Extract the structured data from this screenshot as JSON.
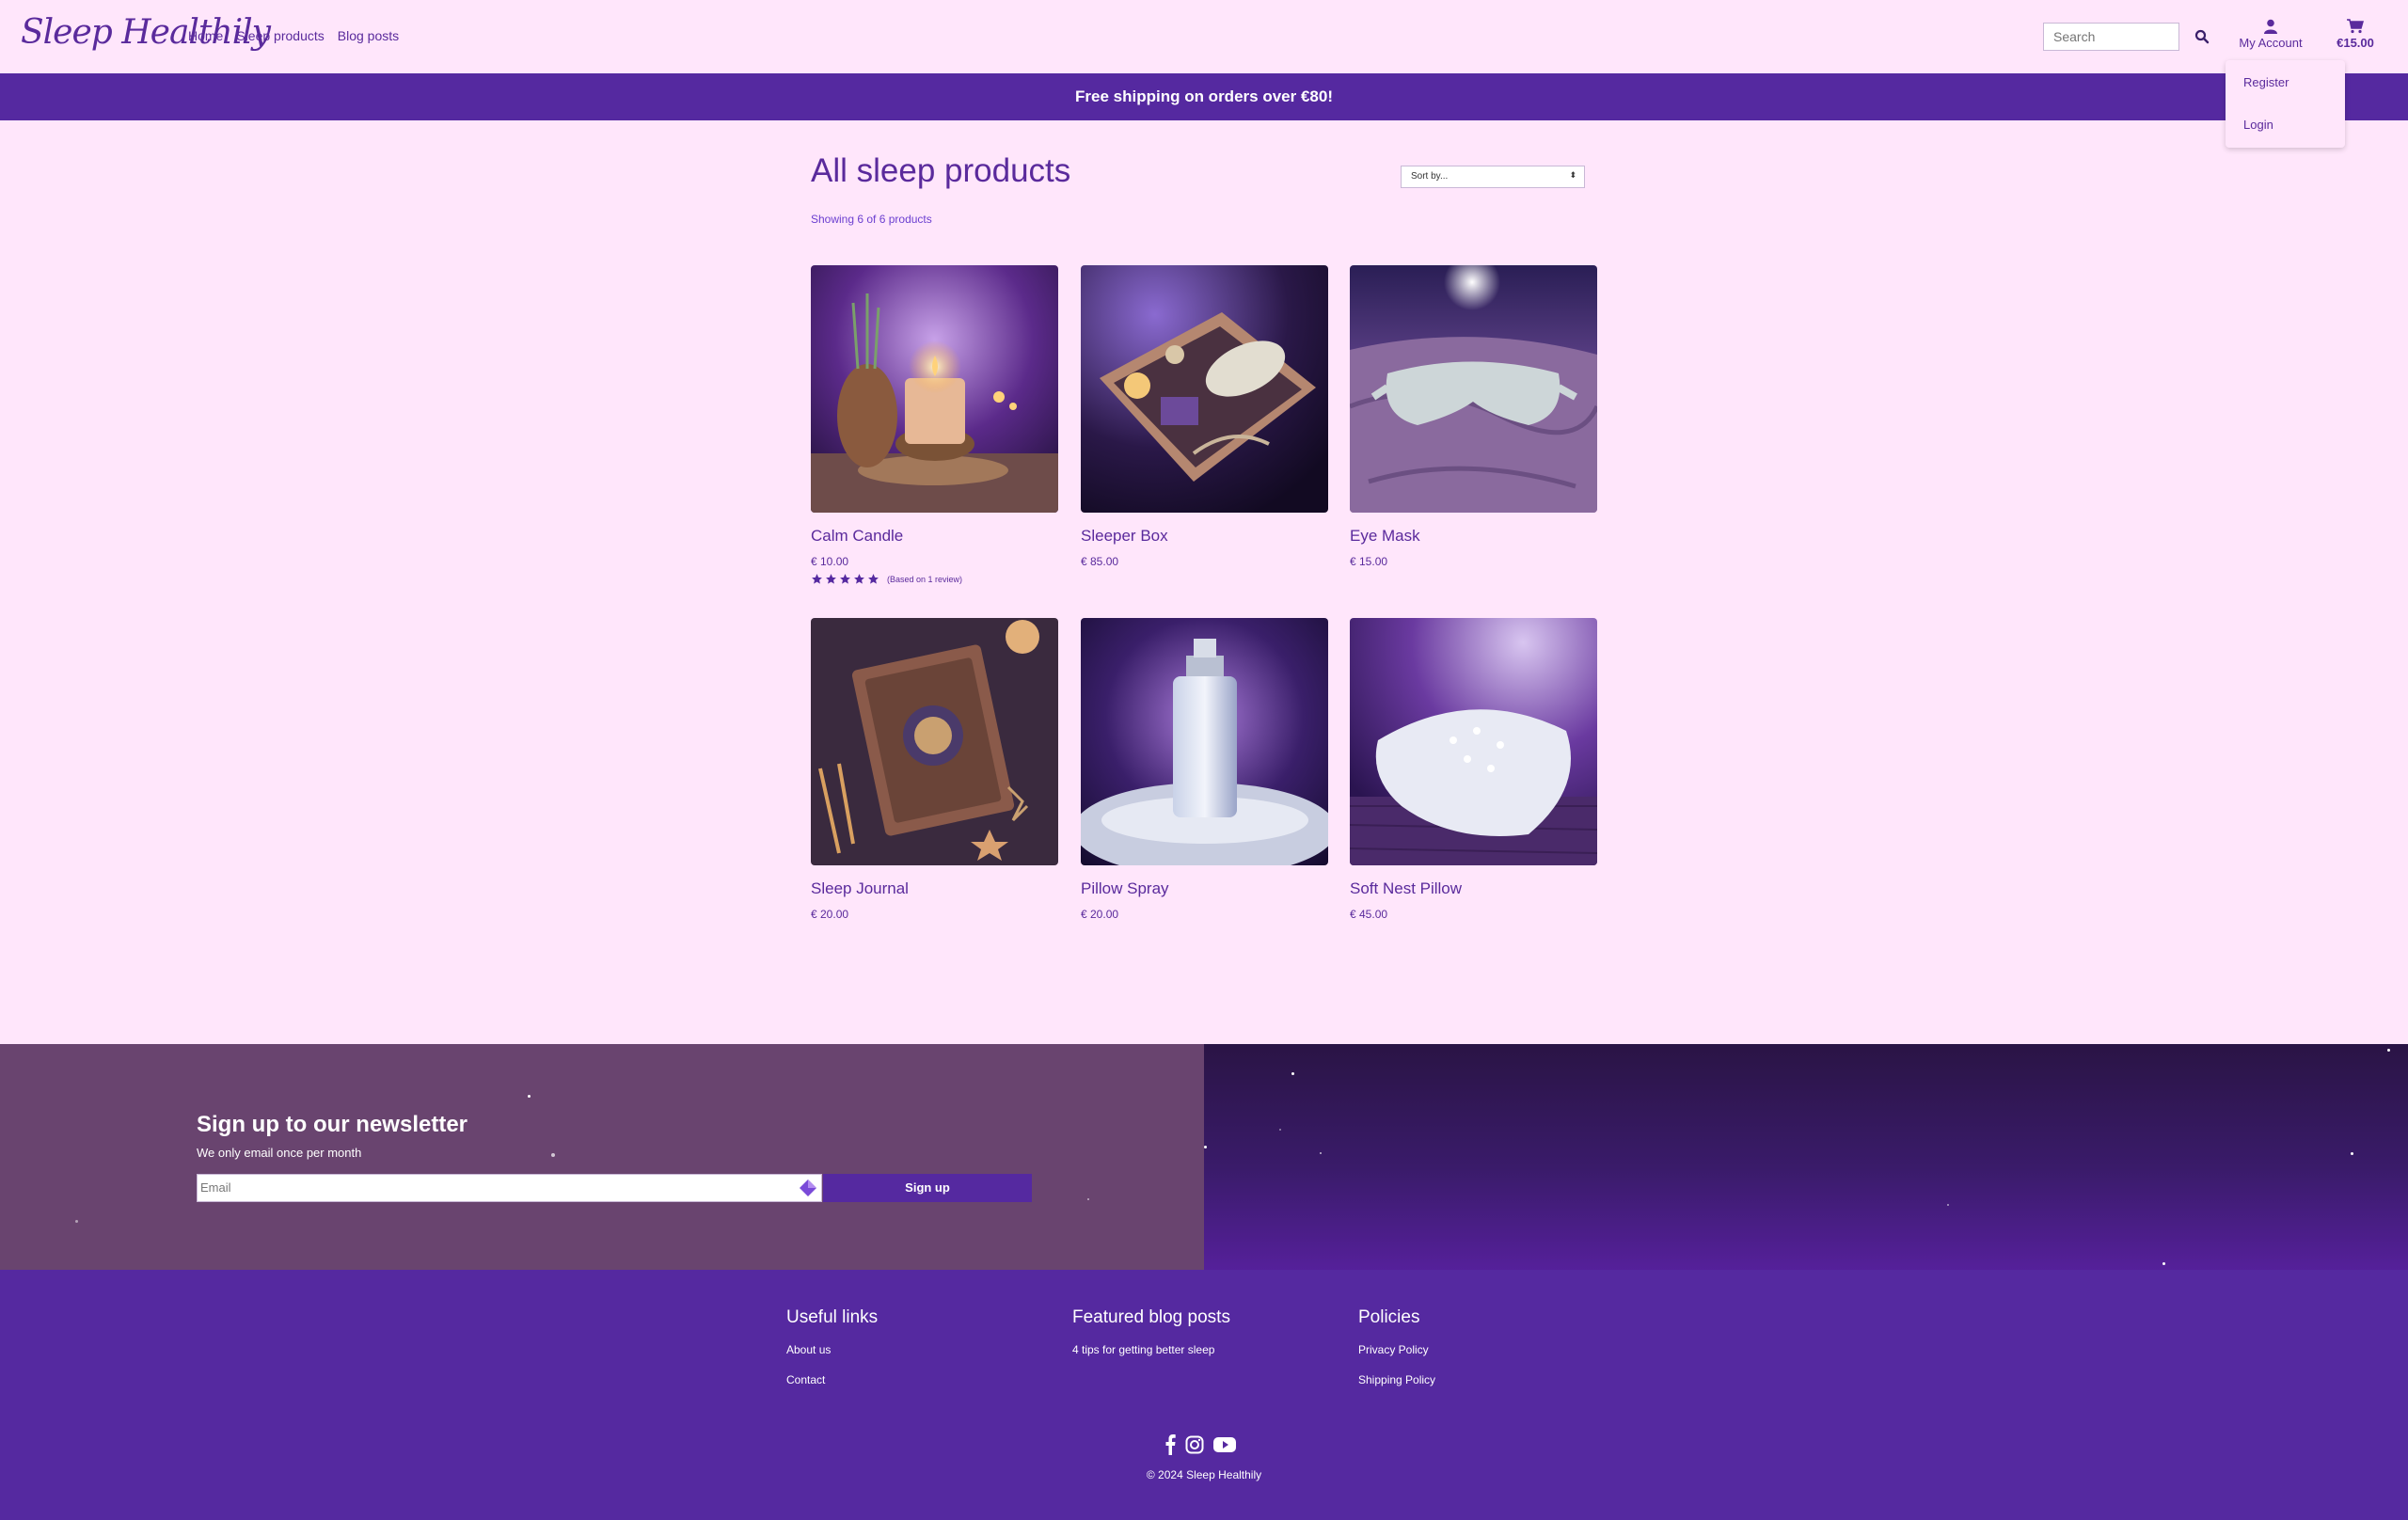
{
  "header": {
    "logo": "Sleep Healthily",
    "nav": [
      "Home",
      "Sleep products",
      "Blog posts"
    ],
    "search_placeholder": "Search",
    "account_label": "My Account",
    "cart_amount": "€15.00"
  },
  "account_menu": {
    "register": "Register",
    "login": "Login"
  },
  "banner": "Free shipping on orders over €80!",
  "main": {
    "title": "All sleep products",
    "sort_placeholder": "Sort by...",
    "showing": "Showing 6 of 6 products",
    "products": [
      {
        "name": "Calm Candle",
        "price": "€ 10.00",
        "rating": 5,
        "reviews": "(Based on 1 review)"
      },
      {
        "name": "Sleeper Box",
        "price": "€ 85.00"
      },
      {
        "name": "Eye Mask",
        "price": "€ 15.00"
      },
      {
        "name": "Sleep Journal",
        "price": "€ 20.00"
      },
      {
        "name": "Pillow Spray",
        "price": "€ 20.00"
      },
      {
        "name": "Soft Nest Pillow",
        "price": "€ 45.00"
      }
    ]
  },
  "newsletter": {
    "title": "Sign up to our newsletter",
    "subtitle": "We only email once per month",
    "email_placeholder": "Email",
    "button": "Sign up"
  },
  "footer": {
    "columns": [
      {
        "title": "Useful links",
        "links": [
          "About us",
          "Contact"
        ]
      },
      {
        "title": "Featured blog posts",
        "links": [
          "4 tips for getting better sleep"
        ]
      },
      {
        "title": "Policies",
        "links": [
          "Privacy Policy",
          "Shipping Policy"
        ]
      }
    ],
    "socials": [
      "facebook-icon",
      "instagram-icon",
      "youtube-icon"
    ],
    "copyright": "© 2024 Sleep Healthily"
  },
  "colors": {
    "background": "#ffe6fb",
    "brand_purple": "#5529a0",
    "text_purple": "#5a2a9c",
    "newsletter_left": "#69446f"
  }
}
